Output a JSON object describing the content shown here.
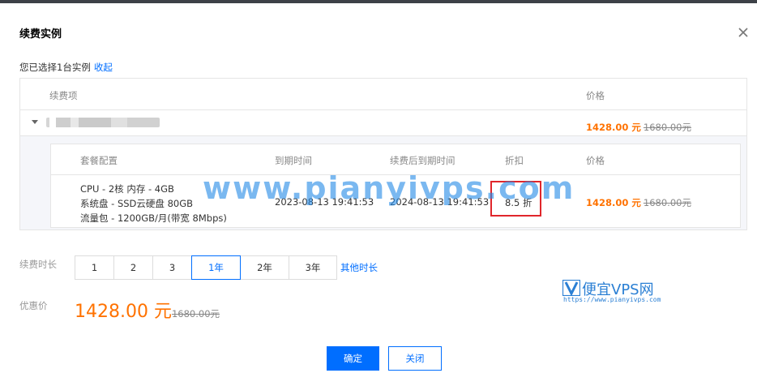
{
  "dialog": {
    "title": "续费实例",
    "selection_text": "您已选择1台实例",
    "collapse_link": "收起"
  },
  "table": {
    "headers": {
      "item": "续费项",
      "price": "价格"
    },
    "instance": {
      "name_blurred": true,
      "price": "1428.00 元",
      "original_price": "1680.00元"
    },
    "detail": {
      "headers": {
        "config": "套餐配置",
        "expire": "到期时间",
        "renew_expire": "续费后到期时间",
        "discount": "折扣",
        "price": "价格"
      },
      "config_lines": [
        "CPU - 2核 内存 - 4GB",
        "系统盘 - SSD云硬盘 80GB",
        "流量包 - 1200GB/月(带宽 8Mbps)"
      ],
      "expire": "2023-08-13 19:41:53",
      "renew_expire": "2024-08-13 19:41:53",
      "discount": "8.5 折",
      "price": "1428.00 元",
      "original_price": "1680.00元"
    }
  },
  "duration": {
    "label": "续费时长",
    "options": [
      "1",
      "2",
      "3",
      "1年",
      "2年",
      "3年"
    ],
    "selected": "1年",
    "other_link": "其他时长"
  },
  "discount_price": {
    "label": "优惠价",
    "price": "1428.00 元",
    "original_price": "1680.00元"
  },
  "buttons": {
    "confirm": "确定",
    "close": "关闭"
  },
  "watermark": {
    "text": "www.pianyivps.com",
    "logo_name": "便宜VPS网",
    "logo_url": "https://www.pianyivps.com"
  },
  "colors": {
    "accent": "#006eff",
    "price": "#ff7200",
    "highlight_box": "#e0262b"
  }
}
